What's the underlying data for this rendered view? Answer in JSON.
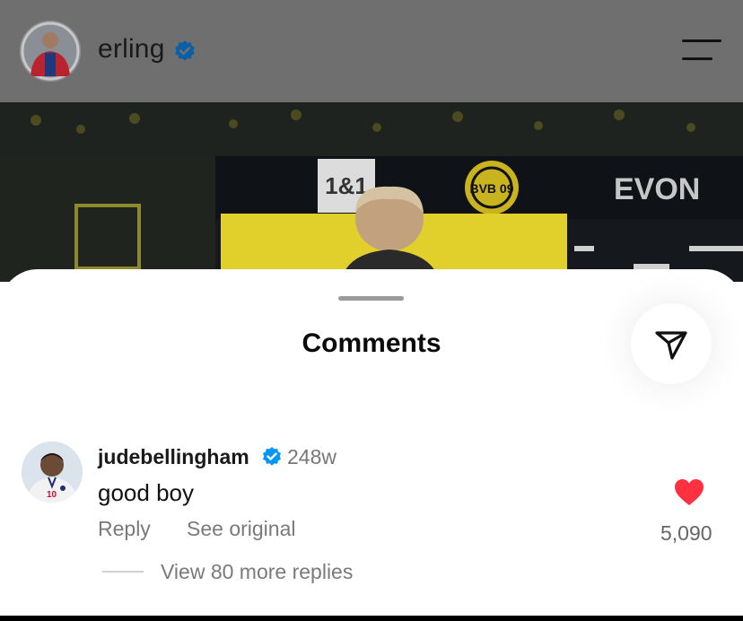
{
  "header": {
    "username": "erling",
    "verified": true,
    "menu_icon": "hamburger-menu-icon"
  },
  "post_image": {
    "signage": [
      "1&1",
      "BVB 09",
      "EVON"
    ]
  },
  "sheet": {
    "title": "Comments",
    "share_icon": "paper-plane-icon"
  },
  "comment": {
    "username": "judebellingham",
    "verified": true,
    "age": "248w",
    "text": "good boy",
    "reply_label": "Reply",
    "see_original_label": "See original",
    "like_count": "5,090",
    "liked": true,
    "view_replies_label": "View 80 more replies"
  },
  "colors": {
    "verified_blue": "#0095f6",
    "like_red": "#ff3040",
    "header_dim": "#6f6f6f"
  }
}
